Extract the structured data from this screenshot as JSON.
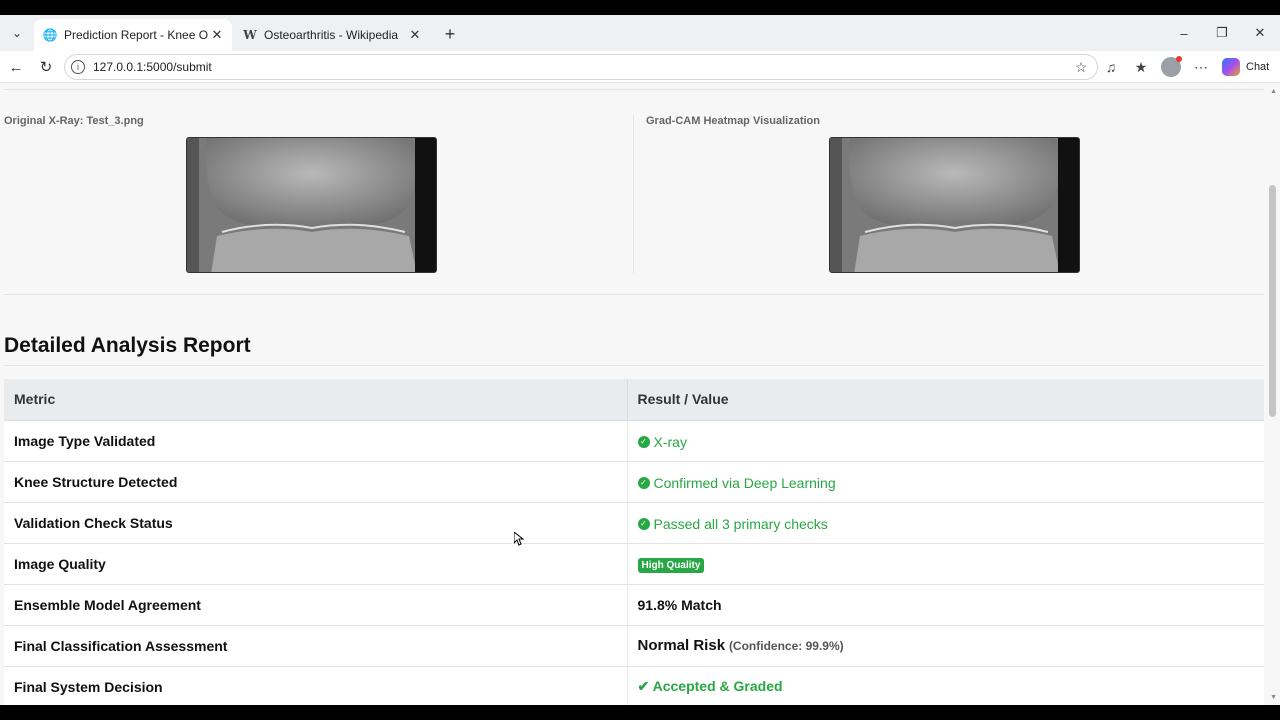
{
  "browser": {
    "tabs": [
      {
        "label": "Prediction Report - Knee Osteoart",
        "active": true
      },
      {
        "label": "Osteoarthritis - Wikipedia",
        "active": false
      }
    ],
    "url": "127.0.0.1:5000/submit",
    "copilot_label": "Chat"
  },
  "images": {
    "original_label": "Original X-Ray: Test_3.png",
    "heatmap_label": "Grad-CAM Heatmap Visualization"
  },
  "report": {
    "title": "Detailed Analysis Report",
    "headers": [
      "Metric",
      "Result / Value"
    ],
    "rows": {
      "image_type": {
        "metric": "Image Type Validated",
        "value": "X-ray"
      },
      "knee_structure": {
        "metric": "Knee Structure Detected",
        "value": "Confirmed via Deep Learning"
      },
      "validation": {
        "metric": "Validation Check Status",
        "value": "Passed all 3 primary checks"
      },
      "quality": {
        "metric": "Image Quality",
        "value": "High Quality"
      },
      "ensemble": {
        "metric": "Ensemble Model Agreement",
        "value": "91.8% Match"
      },
      "classification": {
        "metric": "Final Classification Assessment",
        "value": "Normal Risk",
        "confidence": "(Confidence: 99.9%)"
      },
      "decision": {
        "metric": "Final System Decision",
        "value": "Accepted & Graded"
      }
    }
  },
  "colors": {
    "success": "#28a745",
    "header_bg": "#e9ecef"
  }
}
